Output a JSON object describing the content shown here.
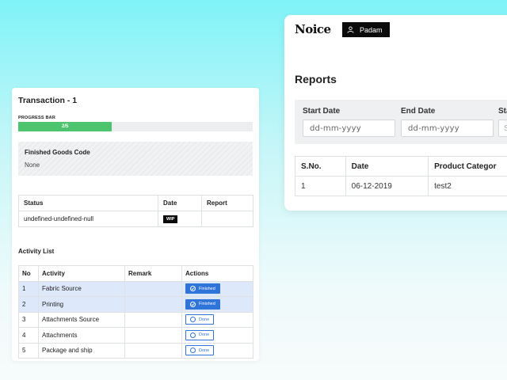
{
  "reports_window": {
    "brand": "Noice",
    "user_name": "Padam",
    "title": "Reports",
    "filters": {
      "start_date_label": "Start Date",
      "start_date_placeholder": "dd-mm-yyyy",
      "end_date_label": "End Date",
      "end_date_placeholder": "dd-mm-yyyy",
      "status_label_partial": "Sta",
      "status_input_partial": "S"
    },
    "table": {
      "headers": [
        "S.No.",
        "Date",
        "Product Categor"
      ],
      "rows": [
        {
          "sno": "1",
          "date": "06-12-2019",
          "category": "test2"
        }
      ]
    }
  },
  "transaction_window": {
    "title": "Transaction - 1",
    "progress_label": "PROGRESS BAR",
    "progress_text": "2/5",
    "progress_fraction": 0.4,
    "finished_goods_label": "Finished Goods Code",
    "finished_goods_value": "None",
    "status_table": {
      "headers": [
        "Status",
        "Date",
        "Report"
      ],
      "row": {
        "status": "undefined-undefined-null",
        "badge": "WIP",
        "report": ""
      }
    },
    "activity_heading": "Activity List",
    "activity_table": {
      "headers": [
        "No",
        "Activity",
        "Remark",
        "Actions"
      ],
      "rows": [
        {
          "no": "1",
          "activity": "Fabric Source",
          "remark": "",
          "action": "Finished"
        },
        {
          "no": "2",
          "activity": "Printing",
          "remark": "",
          "action": "Finished"
        },
        {
          "no": "3",
          "activity": "Attachments Source",
          "remark": "",
          "action": "Done"
        },
        {
          "no": "4",
          "activity": "Attachments",
          "remark": "",
          "action": "Done"
        },
        {
          "no": "5",
          "activity": "Package and ship",
          "remark": "",
          "action": "Done"
        }
      ]
    }
  },
  "colors": {
    "progress_green": "#4fc46f",
    "action_blue": "#2f74d8",
    "finished_row_bg": "#dde9fb",
    "badge_black": "#0b0b0b"
  },
  "icons": {
    "user": "user-icon",
    "finished": "check-circle-icon",
    "done": "circle-icon"
  }
}
